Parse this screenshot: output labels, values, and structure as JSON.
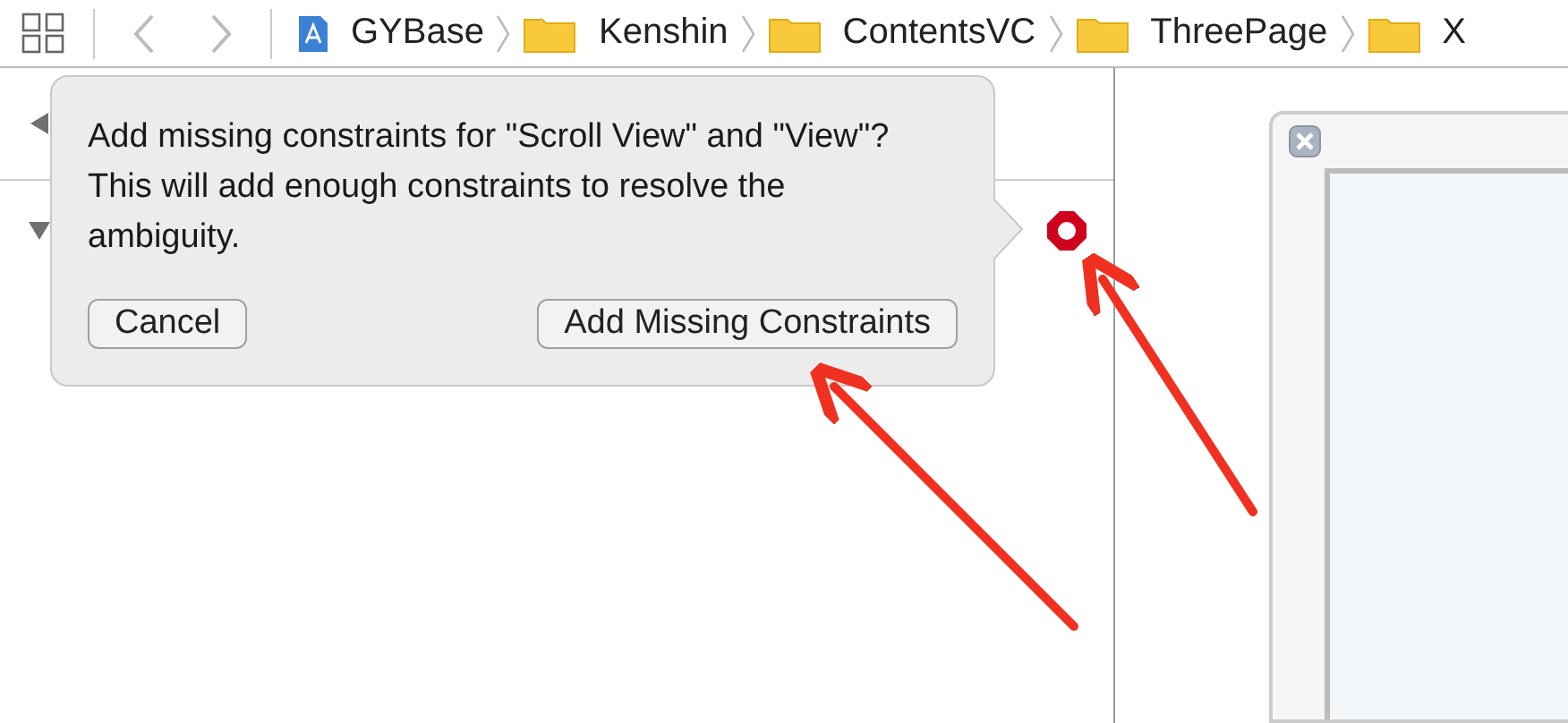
{
  "breadcrumbs": [
    {
      "label": "GYBase",
      "kind": "project"
    },
    {
      "label": "Kenshin",
      "kind": "folder"
    },
    {
      "label": "ContentsVC",
      "kind": "folder"
    },
    {
      "label": "ThreePage",
      "kind": "folder"
    },
    {
      "label": "X",
      "kind": "folder"
    }
  ],
  "outline": [
    {
      "expanded": false
    },
    {
      "expanded": true
    }
  ],
  "popover": {
    "message": "Add missing constraints for \"Scroll View\" and \"View\"? This will add enough constraints to resolve the ambiguity.",
    "buttons": [
      "Cancel",
      "Add Missing Constraints"
    ]
  }
}
